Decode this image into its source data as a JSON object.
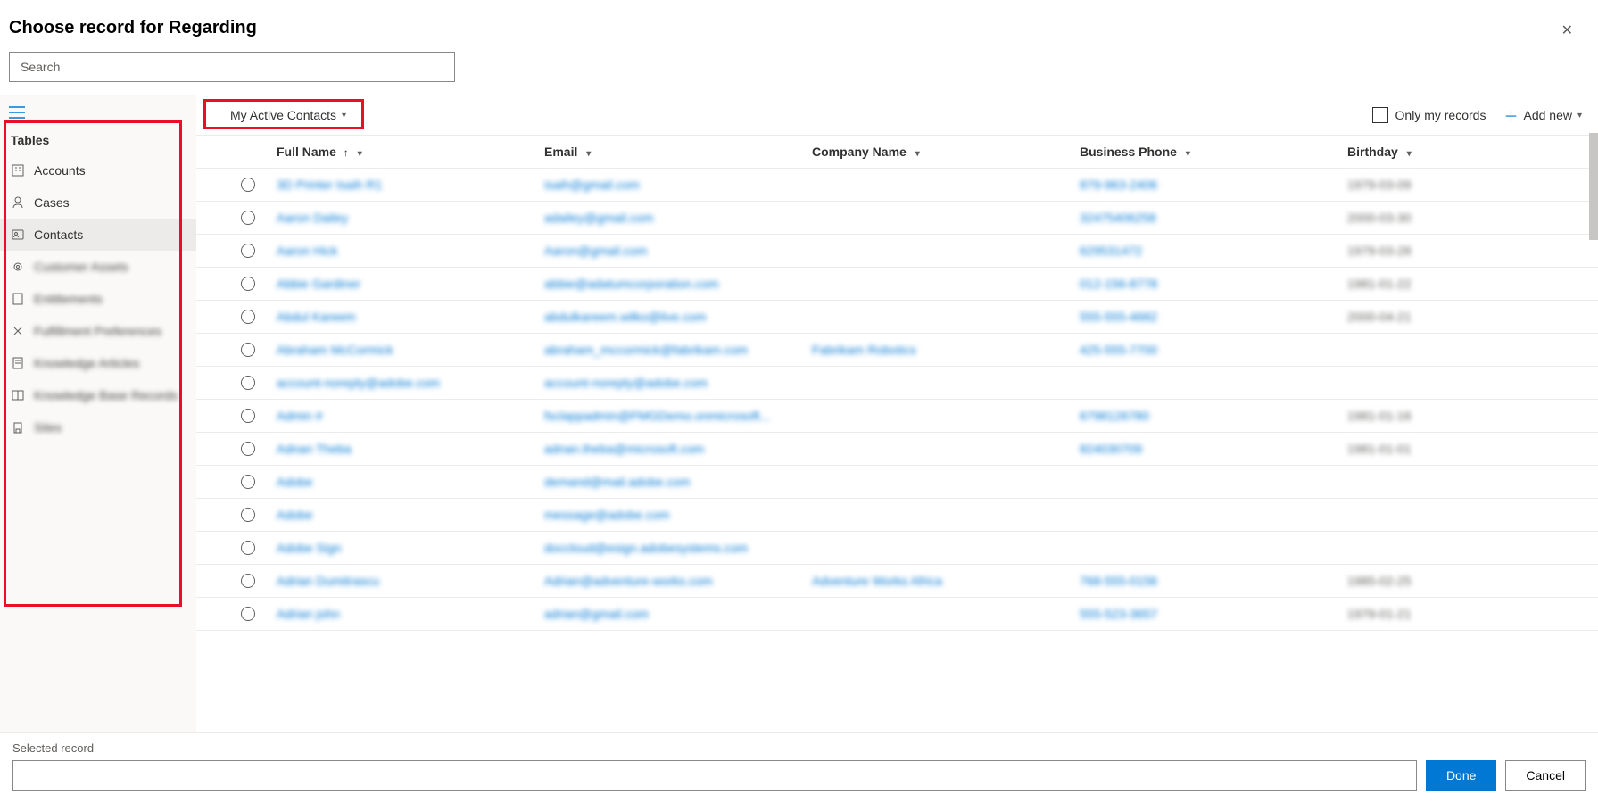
{
  "header": {
    "title": "Choose record for Regarding"
  },
  "search": {
    "placeholder": "Search"
  },
  "sidebar": {
    "heading": "Tables",
    "items": [
      {
        "label": "Accounts",
        "icon": "building",
        "blurred": false
      },
      {
        "label": "Cases",
        "icon": "person",
        "blurred": false
      },
      {
        "label": "Contacts",
        "icon": "contact",
        "blurred": false,
        "active": true
      },
      {
        "label": "Customer Assets",
        "icon": "gear",
        "blurred": true
      },
      {
        "label": "Entitlements",
        "icon": "doc",
        "blurred": true
      },
      {
        "label": "Fulfillment Preferences",
        "icon": "pref",
        "blurred": true
      },
      {
        "label": "Knowledge Articles",
        "icon": "article",
        "blurred": true
      },
      {
        "label": "Knowledge Base Records",
        "icon": "kb",
        "blurred": true
      },
      {
        "label": "Sites",
        "icon": "site",
        "blurred": true
      }
    ]
  },
  "toolbar": {
    "view_label": "My Active Contacts",
    "only_my_label": "Only my records",
    "add_new_label": "Add new"
  },
  "columns": {
    "full_name": "Full Name",
    "email": "Email",
    "company": "Company Name",
    "phone": "Business Phone",
    "birthday": "Birthday"
  },
  "rows": [
    {
      "name": "3D Printer Isaih R1",
      "email": "isaih@gmail.com",
      "company": "",
      "phone": "879-963-2406",
      "bday": "1979-03-09"
    },
    {
      "name": "Aaron Dailey",
      "email": "adailey@gmail.com",
      "company": "",
      "phone": "32475406258",
      "bday": "2000-03-30"
    },
    {
      "name": "Aaron Hick",
      "email": "Aaron@gmail.com",
      "company": "",
      "phone": "629531472",
      "bday": "1979-03-28"
    },
    {
      "name": "Abbie Gardiner",
      "email": "abbie@adatumcorporation.com",
      "company": "",
      "phone": "012-156-8778",
      "bday": "1981-01-22"
    },
    {
      "name": "Abdul Kareem",
      "email": "abdulkareem.wilko@live.com",
      "company": "",
      "phone": "555-555-4682",
      "bday": "2000-04-21"
    },
    {
      "name": "Abraham McCormick",
      "email": "abraham_mccormick@fabrikam.com",
      "company": "Fabrikam Robotics",
      "phone": "425-555-7700",
      "bday": ""
    },
    {
      "name": "account-noreply@adobe.com",
      "email": "account-noreply@adobe.com",
      "company": "",
      "phone": "",
      "bday": ""
    },
    {
      "name": "Admin #",
      "email": "fsclappadmin@FMGDemo.onmicrosoft...",
      "company": "",
      "phone": "6798126780",
      "bday": "1981-01-16"
    },
    {
      "name": "Adnan Theba",
      "email": "adnan.theba@microsoft.com",
      "company": "",
      "phone": "824030709",
      "bday": "1981-01-01"
    },
    {
      "name": "Adobe",
      "email": "demand@mail.adobe.com",
      "company": "",
      "phone": "",
      "bday": ""
    },
    {
      "name": "Adobe",
      "email": "message@adobe.com",
      "company": "",
      "phone": "",
      "bday": ""
    },
    {
      "name": "Adobe Sign",
      "email": "doccloud@esign.adobesystems.com",
      "company": "",
      "phone": "",
      "bday": ""
    },
    {
      "name": "Adrian Dumitrascu",
      "email": "Adrian@adventure-works.com",
      "company": "Adventure Works Africa",
      "phone": "768-555-0156",
      "bday": "1985-02-25"
    },
    {
      "name": "Adrian john",
      "email": "adrian@gmail.com",
      "company": "",
      "phone": "555-523-3657",
      "bday": "1979-01-21"
    }
  ],
  "footer": {
    "selected_label": "Selected record",
    "done_label": "Done",
    "cancel_label": "Cancel"
  }
}
